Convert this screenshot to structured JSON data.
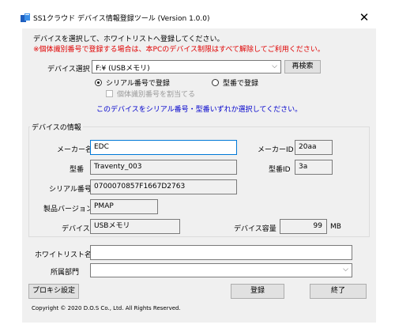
{
  "window": {
    "title": "SS1クラウド デバイス情報登録ツール (Version 1.0.0)",
    "close_glyph": "✕"
  },
  "intro": {
    "line1": "デバイスを選択して、ホワイトリストへ登録してください。",
    "line2": "※個体識別番号で登録する場合は、本PCのデバイス制限はすべて解除してご利用ください。"
  },
  "device_select": {
    "label": "デバイス選択",
    "value": "F:¥ (USBメモリ)",
    "rescan_button": "再検索"
  },
  "register_mode": {
    "serial_option": "シリアル番号で登録",
    "serial_checked": true,
    "model_option": "型番で登録",
    "model_checked": false,
    "assign_id_checkbox": "個体識別番号を割当てる",
    "assign_id_checked": false,
    "hint": "このデバイスをシリアル番号・型番いずれか選択してください。"
  },
  "device_info": {
    "group_title": "デバイスの情報",
    "maker_name_label": "メーカー名",
    "maker_name_value": "EDC",
    "maker_id_label": "メーカーID",
    "maker_id_value": "20aa",
    "model_label": "型番",
    "model_value": "Traventy_003",
    "model_id_label": "型番ID",
    "model_id_value": "3a",
    "serial_label": "シリアル番号",
    "serial_value": "0700070857F1667D2763",
    "product_version_label": "製品バージョン",
    "product_version_value": "PMAP",
    "device_label": "デバイス",
    "device_value": "USBメモリ",
    "capacity_label": "デバイス容量",
    "capacity_value": "99",
    "capacity_unit": "MB"
  },
  "whitelist": {
    "name_label": "ホワイトリスト名",
    "name_value": "",
    "department_label": "所属部門",
    "department_value": ""
  },
  "footer": {
    "proxy_button": "プロキシ設定",
    "register_button": "登録",
    "exit_button": "終了",
    "copyright": "Copyright © 2020 D.O.S Co., Ltd. All Rights Reserved."
  },
  "colors": {
    "warning_text": "#e00000",
    "hint_text": "#0000cc",
    "focus_border": "#0078d7",
    "window_background": "#f0f0f0"
  }
}
